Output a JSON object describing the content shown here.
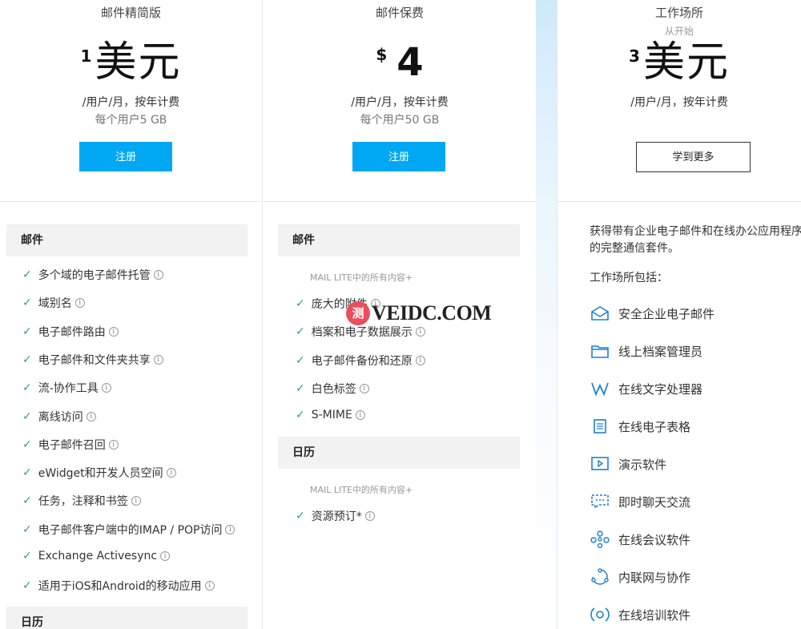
{
  "plans": [
    {
      "name": "邮件精简版",
      "price_lead": "1",
      "price_main": "美元",
      "period": "/用户/月，按年计费",
      "storage": "每个用户5 GB",
      "cta": "注册"
    },
    {
      "name": "邮件保费",
      "price_lead": "$",
      "price_main": "4",
      "period": "/用户/月，按年计费",
      "storage": "每个用户50 GB",
      "cta": "注册"
    },
    {
      "name": "工作场所",
      "sub": "从开始",
      "price_lead": "3",
      "price_main": "美元",
      "period": "/用户/月，按年计费",
      "cta": "学到更多"
    }
  ],
  "col1": {
    "mail_header": "邮件",
    "mail_features": [
      "多个域的电子邮件托管",
      "域别名",
      "电子邮件路由",
      "电子邮件和文件夹共享",
      "流-协作工具",
      "离线访问",
      "电子邮件召回",
      "eWidget和开发人员空间",
      "任务，注释和书签",
      "电子邮件客户端中的IMAP / POP访问",
      "Exchange Activesync",
      "适用于iOS和Android的移动应用"
    ],
    "calendar_header": "日历"
  },
  "col2": {
    "mail_header": "邮件",
    "mail_note": "MAIL LITE中的所有内容+",
    "mail_features": [
      "庞大的附件",
      "档案和电子数据展示",
      "电子邮件备份和还原",
      "白色标签",
      "S-MIME"
    ],
    "calendar_header": "日历",
    "calendar_note": "MAIL LITE中的所有内容+",
    "calendar_features": [
      "资源预订*"
    ]
  },
  "col3": {
    "description": [
      "获得带有企业电子邮件和在线办公应用程序",
      "的完整通信套件。"
    ],
    "includes_label": "工作场所包括：",
    "items": [
      {
        "label": "安全企业电子邮件",
        "icon": "mail-icon"
      },
      {
        "label": "线上档案管理员",
        "icon": "folder-icon"
      },
      {
        "label": "在线文字处理器",
        "icon": "writer-icon"
      },
      {
        "label": "在线电子表格",
        "icon": "sheet-icon"
      },
      {
        "label": "演示软件",
        "icon": "presentation-icon"
      },
      {
        "label": "即时聊天交流",
        "icon": "chat-icon"
      },
      {
        "label": "在线会议软件",
        "icon": "meeting-icon"
      },
      {
        "label": "内联网与协作",
        "icon": "intranet-icon"
      },
      {
        "label": "在线培训软件",
        "icon": "training-icon"
      }
    ]
  },
  "watermark": {
    "badge": "测",
    "text": "VEIDC.COM"
  },
  "colors": {
    "accent": "#00a8f3",
    "check": "#2a9d8f",
    "icon": "#1f7fd0"
  }
}
